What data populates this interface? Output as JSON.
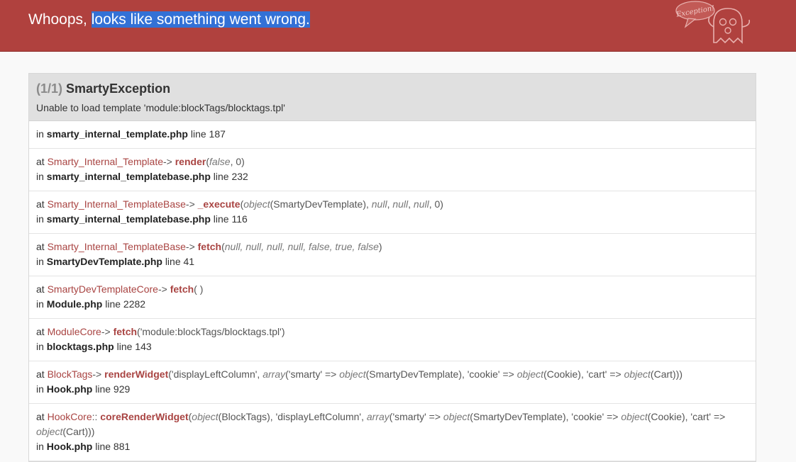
{
  "header": {
    "title_prefix": "Whoops, ",
    "title_selected": "looks like something went wrong.",
    "mascot_bubble": "Exception!"
  },
  "exception": {
    "count": "(1/1)",
    "name": "SmartyException",
    "message": "Unable to load template 'module:blockTags/blocktags.tpl'"
  },
  "frames": {
    "0": {
      "in": "in",
      "file": "smarty_internal_template.php",
      "line": "line 187"
    },
    "1": {
      "at": "at",
      "cls": "Smarty_Internal_Template",
      "arrow": "->",
      "fn": "render",
      "open": "(",
      "a1": "false",
      "c1": ", ",
      "a2": "0",
      "close": ")",
      "in": "in",
      "file": "smarty_internal_templatebase.php",
      "line": "line 232"
    },
    "2": {
      "at": "at",
      "cls": "Smarty_Internal_TemplateBase",
      "arrow": "->",
      "fn": "_execute",
      "open": "(",
      "a1": "object",
      "a2": "(SmartyDevTemplate), ",
      "a3": "null",
      "c3": ", ",
      "a4": "null",
      "c4": ", ",
      "a5": "null",
      "c5": ", ",
      "a6": "0",
      "close": ")",
      "in": "in",
      "file": "smarty_internal_templatebase.php",
      "line": "line 116"
    },
    "3": {
      "at": "at",
      "cls": "Smarty_Internal_TemplateBase",
      "arrow": "->",
      "fn": "fetch",
      "open": "(",
      "args": "null, null, null, null, false, true, false",
      "close": ")",
      "in": "in",
      "file": "SmartyDevTemplate.php",
      "line": "line 41"
    },
    "4": {
      "at": "at",
      "cls": "SmartyDevTemplateCore",
      "arrow": "->",
      "fn": "fetch",
      "open": "( )",
      "in": "in",
      "file": "Module.php",
      "line": "line 2282"
    },
    "5": {
      "at": "at",
      "cls": "ModuleCore",
      "arrow": "->",
      "fn": "fetch",
      "open": "(",
      "args": "'module:blockTags/blocktags.tpl'",
      "close": ")",
      "in": "in",
      "file": "blocktags.php",
      "line": "line 143"
    },
    "6": {
      "at": "at",
      "cls": "BlockTags",
      "arrow": "->",
      "fn": "renderWidget",
      "open": "(",
      "p1": "'displayLeftColumn', ",
      "k1": "array",
      "p2": "('smarty' => ",
      "k2": "object",
      "p3": "(SmartyDevTemplate), 'cookie' => ",
      "k3": "object",
      "p4": "(Cookie), 'cart' => ",
      "k4": "object",
      "p5": "(Cart)))",
      "in": "in",
      "file": "Hook.php",
      "line": "line 929"
    },
    "7": {
      "at": "at",
      "cls": "HookCore",
      "arrow": "::",
      "fn": "coreRenderWidget",
      "open": "(",
      "k1": "object",
      "p1": "(BlockTags), 'displayLeftColumn', ",
      "k2": "array",
      "p2": "('smarty' => ",
      "k3": "object",
      "p3": "(SmartyDevTemplate), 'cookie' => ",
      "k4": "object",
      "p4": "(Cookie), 'cart' => ",
      "k5": "object",
      "p5": "(Cart)))",
      "in": "in",
      "file": "Hook.php",
      "line": "line 881"
    }
  },
  "colors": {
    "header": "#b0413e",
    "class_name": "#a94442",
    "selection": "#3371d6"
  }
}
